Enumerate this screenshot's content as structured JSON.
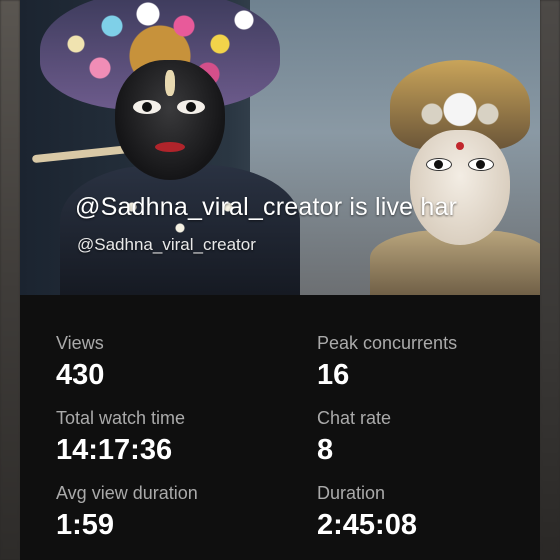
{
  "stream": {
    "title": "@Sadhna_viral_creator is live har",
    "handle": "@Sadhna_viral_creator"
  },
  "stats": [
    {
      "label": "Views",
      "value": "430"
    },
    {
      "label": "Peak concurrents",
      "value": "16"
    },
    {
      "label": "Total watch time",
      "value": "14:17:36"
    },
    {
      "label": "Chat rate",
      "value": "8"
    },
    {
      "label": "Avg view duration",
      "value": "1:59"
    },
    {
      "label": "Duration",
      "value": "2:45:08"
    }
  ],
  "colors": {
    "panel_bg": "#0f0f0f",
    "label": "#aaaaaa",
    "value": "#ffffff"
  }
}
